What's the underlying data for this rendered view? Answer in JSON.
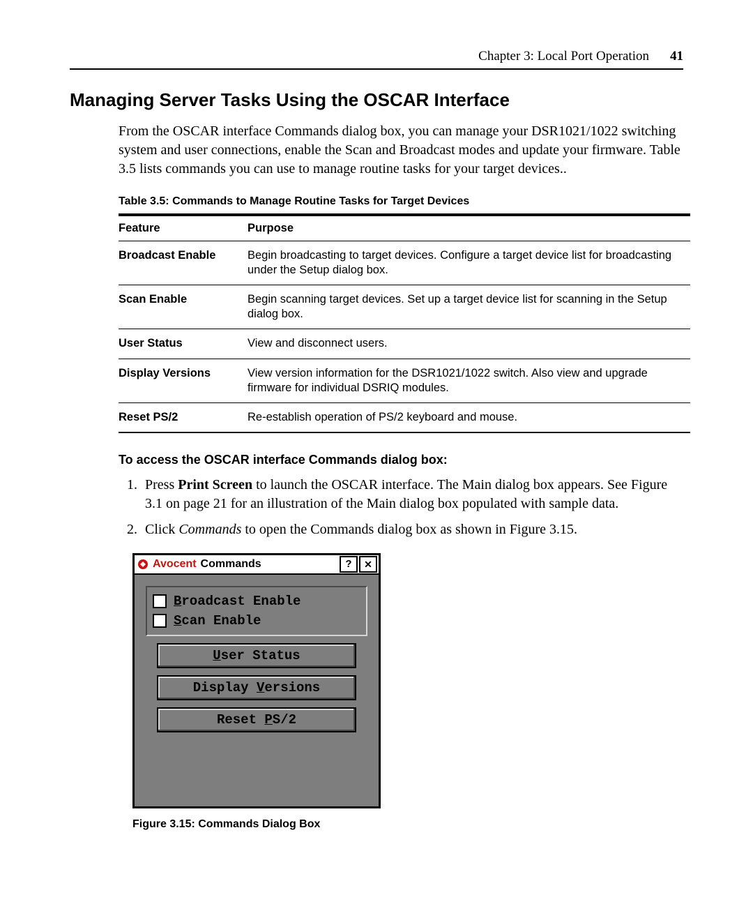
{
  "header": {
    "chapter": "Chapter 3: Local Port Operation",
    "page": "41"
  },
  "heading": "Managing Server Tasks Using the OSCAR Interface",
  "intro": "From the OSCAR interface Commands dialog box, you can manage your DSR1021/1022 switching system and user connections, enable the Scan and Broadcast modes and update your firmware. Table 3.5 lists commands you can use to manage routine tasks for your target devices..",
  "table": {
    "caption": "Table 3.5: Commands to Manage Routine Tasks for Target Devices",
    "headers": {
      "feature": "Feature",
      "purpose": "Purpose"
    },
    "rows": [
      {
        "feature": "Broadcast Enable",
        "purpose": "Begin broadcasting to target devices. Configure a target device list for broadcasting under the Setup dialog box."
      },
      {
        "feature": "Scan Enable",
        "purpose": "Begin scanning target devices. Set up a target device list for scanning in the Setup dialog box."
      },
      {
        "feature": "User Status",
        "purpose": "View and disconnect users."
      },
      {
        "feature": "Display Versions",
        "purpose": "View version information for the DSR1021/1022 switch. Also view and upgrade firmware for individual DSRIQ modules."
      },
      {
        "feature": "Reset PS/2",
        "purpose": "Re-establish operation of PS/2 keyboard and mouse."
      }
    ]
  },
  "subheading": "To access the OSCAR interface Commands dialog box:",
  "steps": {
    "s1_pre": "Press ",
    "s1_bold": "Print Screen",
    "s1_post": " to launch the OSCAR interface. The Main dialog box appears. See Figure 3.1 on page 21 for an illustration of the Main dialog box populated with sample data.",
    "s2_pre": "Click ",
    "s2_ital": "Commands",
    "s2_post": " to open the Commands dialog box as shown in Figure 3.15."
  },
  "dialog": {
    "brand": "Avocent",
    "title": "Commands",
    "help": "?",
    "checks": {
      "broadcast": {
        "u": "B",
        "rest": "roadcast Enable"
      },
      "scan": {
        "u": "S",
        "rest": "can Enable"
      }
    },
    "buttons": {
      "user": {
        "u": "U",
        "rest": "ser Status"
      },
      "display": {
        "pre": "Display ",
        "u": "V",
        "rest2": "ersions"
      },
      "reset": {
        "pre": "Reset ",
        "u": "P",
        "rest2": "S/2"
      }
    }
  },
  "figure_caption": "Figure 3.15: Commands Dialog Box"
}
